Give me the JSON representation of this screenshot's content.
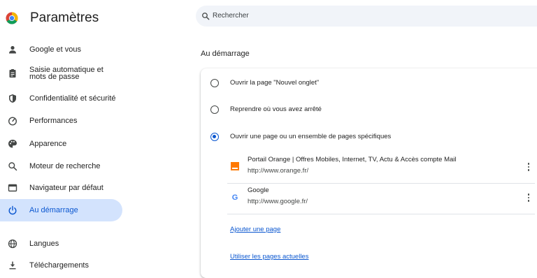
{
  "app": {
    "title": "Paramètres",
    "logo_icon": "chrome-logo-icon"
  },
  "sidebar": {
    "items": [
      {
        "label": "Google et vous",
        "icon": "person-icon"
      },
      {
        "label": "Saisie automatique et mots de passe",
        "icon": "clipboard-icon"
      },
      {
        "label": "Confidentialité et sécurité",
        "icon": "shield-icon"
      },
      {
        "label": "Performances",
        "icon": "speedometer-icon"
      },
      {
        "label": "Apparence",
        "icon": "palette-icon"
      },
      {
        "label": "Moteur de recherche",
        "icon": "search-icon"
      },
      {
        "label": "Navigateur par défaut",
        "icon": "browser-window-icon"
      },
      {
        "label": "Au démarrage",
        "icon": "power-icon",
        "active": true
      },
      {
        "label": "Langues",
        "icon": "globe-icon"
      },
      {
        "label": "Téléchargements",
        "icon": "download-icon"
      }
    ]
  },
  "search": {
    "placeholder": "Rechercher"
  },
  "startup": {
    "section_title": "Au démarrage",
    "options": [
      {
        "label": "Ouvrir la page \"Nouvel onglet\"",
        "checked": false
      },
      {
        "label": "Reprendre où vous avez arrêté",
        "checked": false
      },
      {
        "label": "Ouvrir une page ou un ensemble de pages spécifiques",
        "checked": true
      }
    ],
    "pages": [
      {
        "title": "Portail Orange | Offres Mobiles, Internet, TV, Actu & Accès compte Mail",
        "url": "http://www.orange.fr/",
        "favicon": "orange-favicon-icon"
      },
      {
        "title": "Google",
        "url": "http://www.google.fr/",
        "favicon": "google-favicon-icon"
      }
    ],
    "add_page_label": "Ajouter une page",
    "use_current_label": "Utiliser les pages actuelles"
  },
  "colors": {
    "accent": "#0b57d0",
    "active_bg": "#d3e3fd",
    "search_bg": "#f1f4f9"
  }
}
